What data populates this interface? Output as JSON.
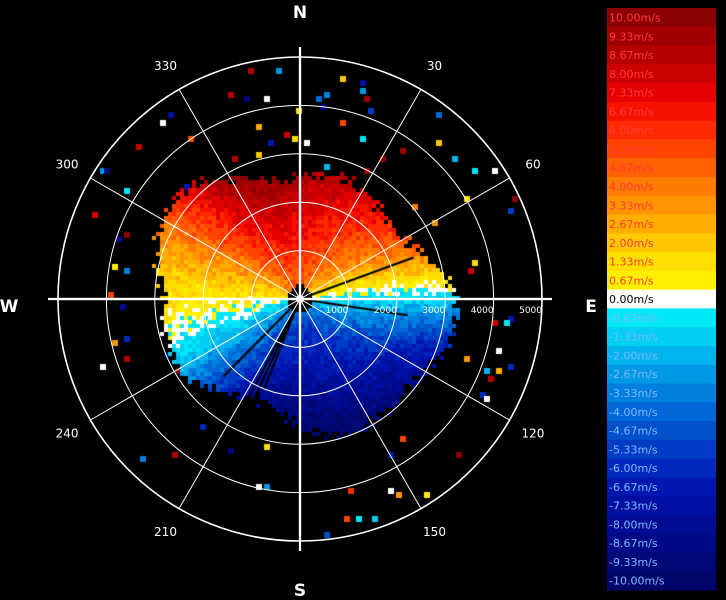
{
  "chart_data": {
    "type": "heatmap",
    "cardinals": [
      "N",
      "E",
      "S",
      "W"
    ],
    "azimuth_labels": [
      "30",
      "60",
      "120",
      "150",
      "210",
      "240",
      "300",
      "330"
    ],
    "range_labels": [
      "1000",
      "2000",
      "3000",
      "4000",
      "5000"
    ],
    "range_max": 5000,
    "legend": [
      {
        "label": "10.00m/s",
        "color": "#8b0000"
      },
      {
        "label": "9.33m/s",
        "color": "#a00000"
      },
      {
        "label": "8.67m/s",
        "color": "#b50000"
      },
      {
        "label": "8.00m/s",
        "color": "#cc0000"
      },
      {
        "label": "7.33m/s",
        "color": "#e40000"
      },
      {
        "label": "6.67m/s",
        "color": "#f51200"
      },
      {
        "label": "6.00m/s",
        "color": "#ff2a00"
      },
      {
        "label": "5.33m/s",
        "color": "#ff4400"
      },
      {
        "label": "4.67m/s",
        "color": "#ff6000"
      },
      {
        "label": "4.00m/s",
        "color": "#ff7a00"
      },
      {
        "label": "3.33m/s",
        "color": "#ff9400"
      },
      {
        "label": "2.67m/s",
        "color": "#ffae00"
      },
      {
        "label": "2.00m/s",
        "color": "#ffc800"
      },
      {
        "label": "1.33m/s",
        "color": "#ffdf00"
      },
      {
        "label": "0.67m/s",
        "color": "#fff000"
      },
      {
        "label": "0.00m/s",
        "color": "#ffffff"
      },
      {
        "label": "-0.67m/s",
        "color": "#00e8f8"
      },
      {
        "label": "-1.33m/s",
        "color": "#00cff4"
      },
      {
        "label": "-2.00m/s",
        "color": "#00b4ee"
      },
      {
        "label": "-2.67m/s",
        "color": "#0099e6"
      },
      {
        "label": "-3.33m/s",
        "color": "#0080de"
      },
      {
        "label": "-4.00m/s",
        "color": "#0068d6"
      },
      {
        "label": "-4.67m/s",
        "color": "#0050cc"
      },
      {
        "label": "-5.33m/s",
        "color": "#003cc4"
      },
      {
        "label": "-6.00m/s",
        "color": "#0028bc"
      },
      {
        "label": "-6.67m/s",
        "color": "#0018b0"
      },
      {
        "label": "-7.33m/s",
        "color": "#0010a2"
      },
      {
        "label": "-8.00m/s",
        "color": "#000c94"
      },
      {
        "label": "-8.67m/s",
        "color": "#000a86"
      },
      {
        "label": "-9.33m/s",
        "color": "#000878"
      },
      {
        "label": "-10.00m/s",
        "color": "#00066a"
      }
    ]
  }
}
